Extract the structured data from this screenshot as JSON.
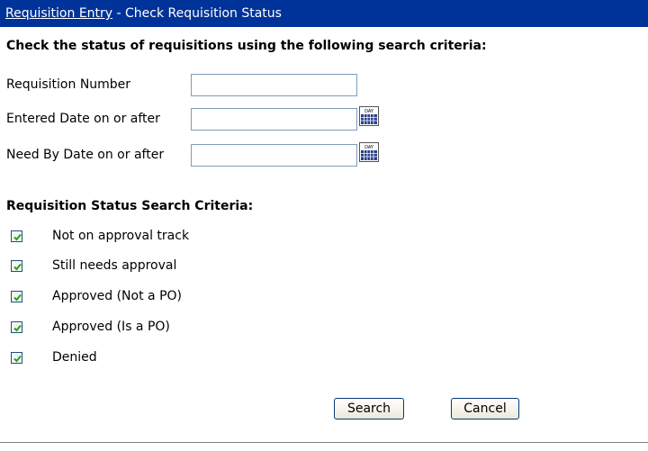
{
  "header": {
    "breadcrumb_link": "Requisition Entry",
    "separator": " - ",
    "page_title": "Check Requisition Status"
  },
  "search_section": {
    "heading": "Check the status of requisitions using the following search criteria:",
    "fields": [
      {
        "label": "Requisition Number",
        "value": "",
        "has_calendar": false
      },
      {
        "label": "Entered Date on or after",
        "value": "",
        "has_calendar": true,
        "icon": "calendar-icon"
      },
      {
        "label": "Need By Date on or after",
        "value": "",
        "has_calendar": true,
        "icon": "calendar-icon"
      }
    ]
  },
  "status_section": {
    "heading": "Requisition Status Search Criteria:",
    "options": [
      {
        "label": "Not on approval track",
        "checked": true
      },
      {
        "label": "Still needs approval",
        "checked": true
      },
      {
        "label": "Approved (Not a PO)",
        "checked": true
      },
      {
        "label": "Approved (Is a PO)",
        "checked": true
      },
      {
        "label": "Denied",
        "checked": true
      }
    ]
  },
  "buttons": {
    "search_label": "Search",
    "cancel_label": "Cancel"
  },
  "calendar_icon_text": "DAY",
  "colors": {
    "title_bar": "#003399",
    "checkmark": "#21a121",
    "input_border": "#7f9db9",
    "calendar_grid": "#2a3e8c"
  }
}
